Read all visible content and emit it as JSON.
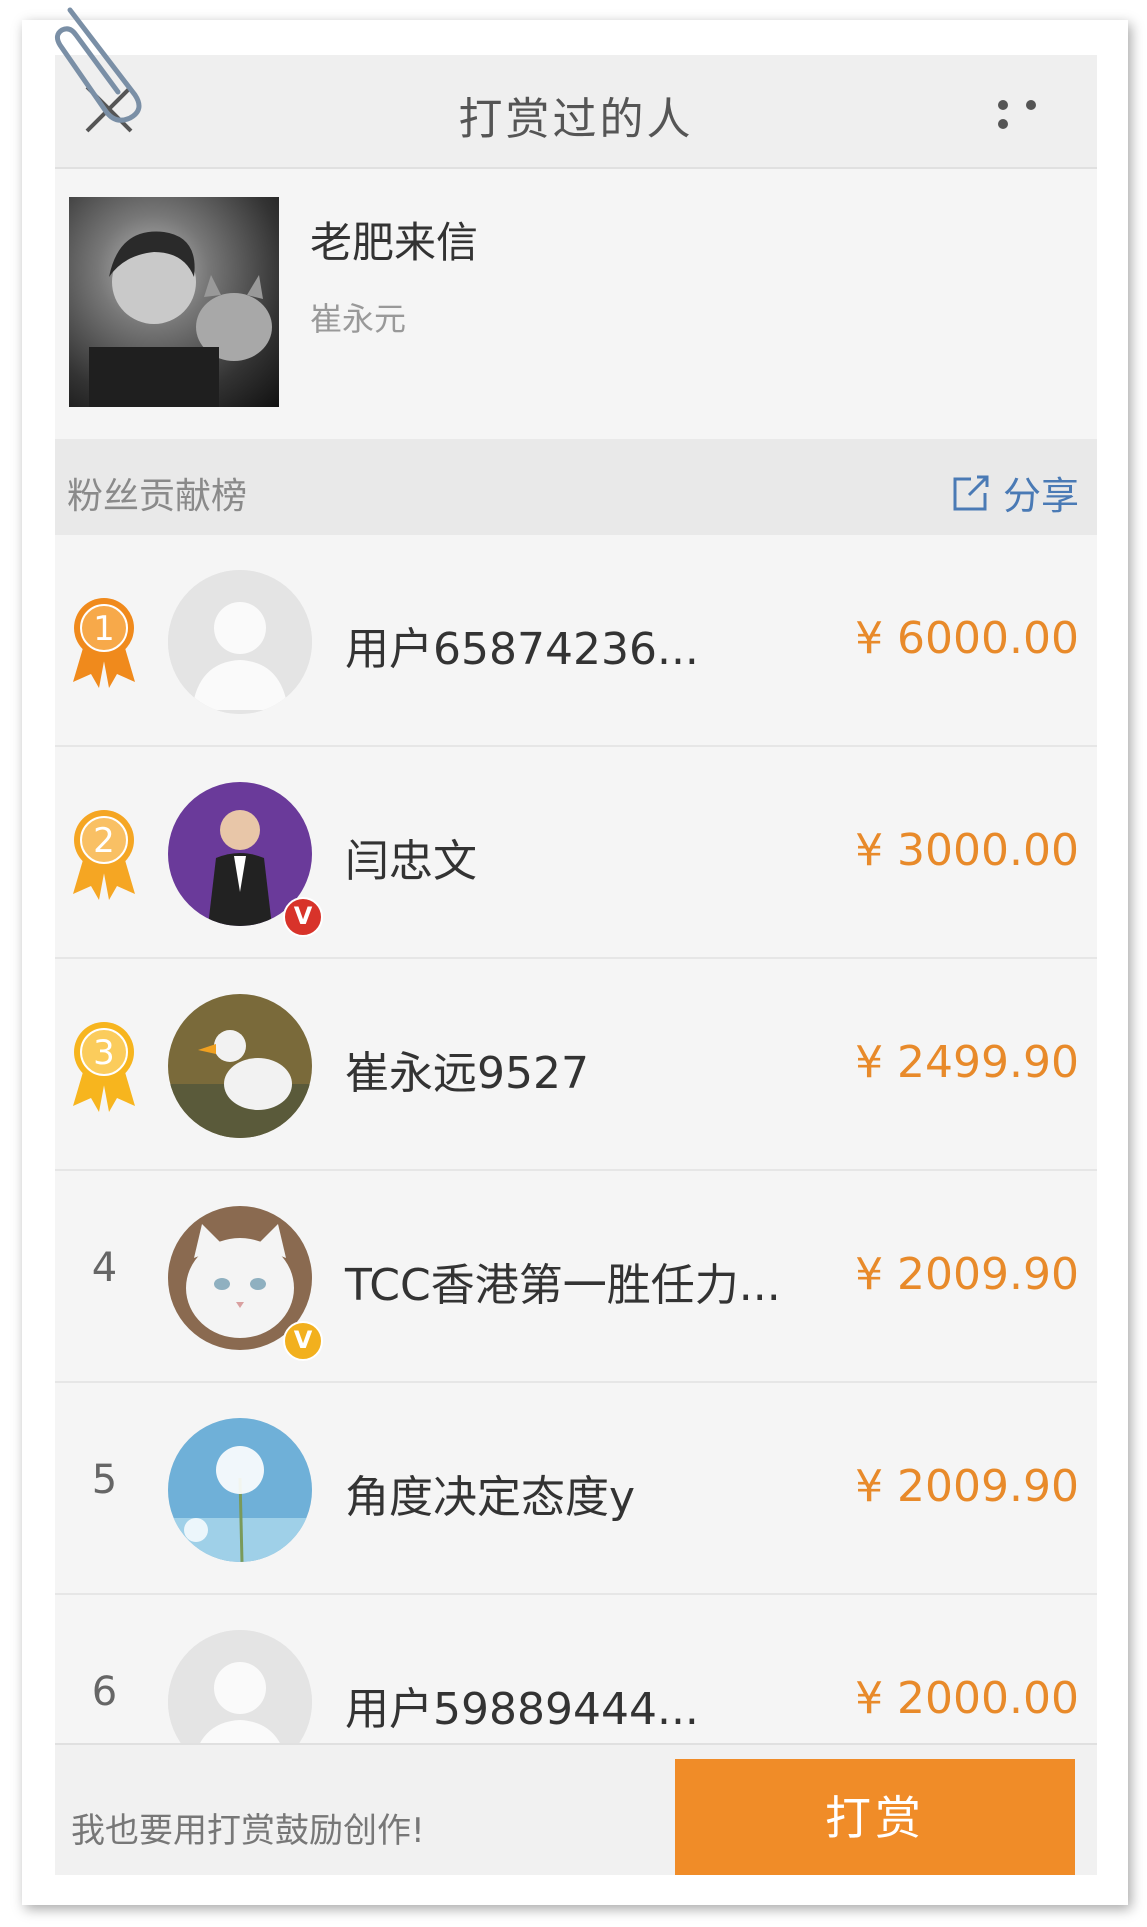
{
  "header": {
    "title": "打赏过的人"
  },
  "profile": {
    "name": "老肥来信",
    "author": "崔永元"
  },
  "section": {
    "title": "粉丝贡献榜",
    "share_label": "分享"
  },
  "donors": [
    {
      "rank": "1",
      "name": "用户65874236...",
      "amount": "¥ 6000.00",
      "medal_color": "#f08a1c",
      "avatar": "default",
      "verified": false
    },
    {
      "rank": "2",
      "name": "闫忠文",
      "amount": "¥ 3000.00",
      "medal_color": "#f5a623",
      "avatar": "person-purple",
      "verified": true,
      "verified_color": "#d8332a"
    },
    {
      "rank": "3",
      "name": "崔永远9527",
      "amount": "¥ 2499.90",
      "medal_color": "#f7b51e",
      "avatar": "duck",
      "verified": false
    },
    {
      "rank": "4",
      "name": "TCC香港第一胜任力...",
      "amount": "¥ 2009.90",
      "avatar": "cat",
      "verified": true,
      "verified_color": "#f2b01e"
    },
    {
      "rank": "5",
      "name": "角度决定态度y",
      "amount": "¥ 2009.90",
      "avatar": "dandelion",
      "verified": false
    },
    {
      "rank": "6",
      "name": "用户59889444...",
      "amount": "¥ 2000.00",
      "avatar": "default",
      "verified": false
    }
  ],
  "verified_badge_label": "V",
  "bottom": {
    "cta_text": "我也要用打赏鼓励创作!",
    "reward_button_label": "打赏"
  },
  "colors": {
    "accent": "#f08c28",
    "amount": "#e88a2a",
    "share": "#4a7ab5"
  }
}
